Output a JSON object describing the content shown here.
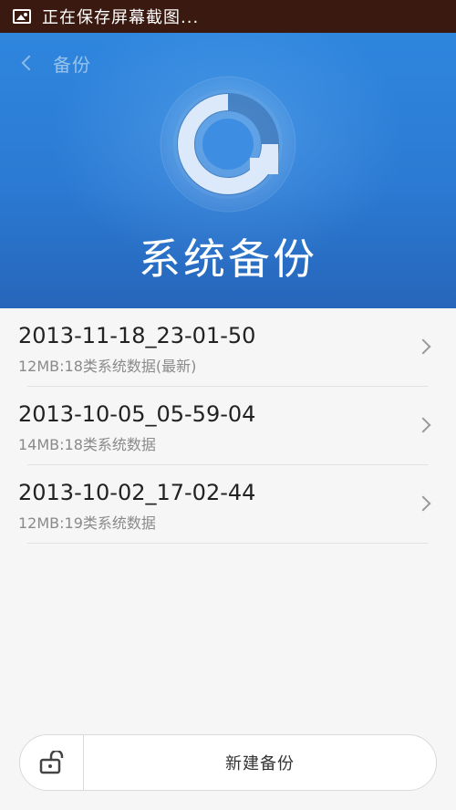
{
  "status_bar": {
    "text": "正在保存屏幕截图..."
  },
  "header": {
    "back_label": "备份",
    "title": "系统备份"
  },
  "backups": [
    {
      "title": "2013-11-18_23-01-50",
      "subtitle": "12MB:18类系统数据(最新)"
    },
    {
      "title": "2013-10-05_05-59-04",
      "subtitle": "14MB:18类系统数据"
    },
    {
      "title": "2013-10-02_17-02-44",
      "subtitle": "12MB:19类系统数据"
    }
  ],
  "bottom_bar": {
    "new_backup_label": "新建备份"
  },
  "colors": {
    "status_bar": "#3a1a10",
    "header_blue": "#2b7ad3",
    "background": "#f6f6f6"
  }
}
